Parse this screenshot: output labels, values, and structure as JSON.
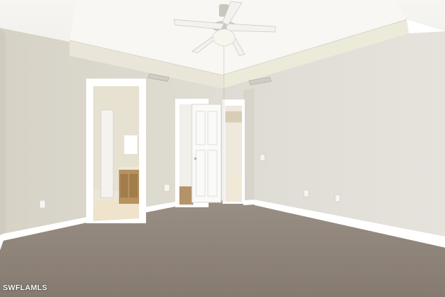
{
  "watermark": {
    "text": "SWFLAMLS"
  },
  "palette": {
    "wall_left": "#dcd8cd",
    "wall_right": "#e1ded6",
    "ceiling": "#f3f2ee",
    "carpet": "#8d8176",
    "trim": "#ffffff"
  },
  "icons": [
    "ceiling-fan-icon"
  ]
}
